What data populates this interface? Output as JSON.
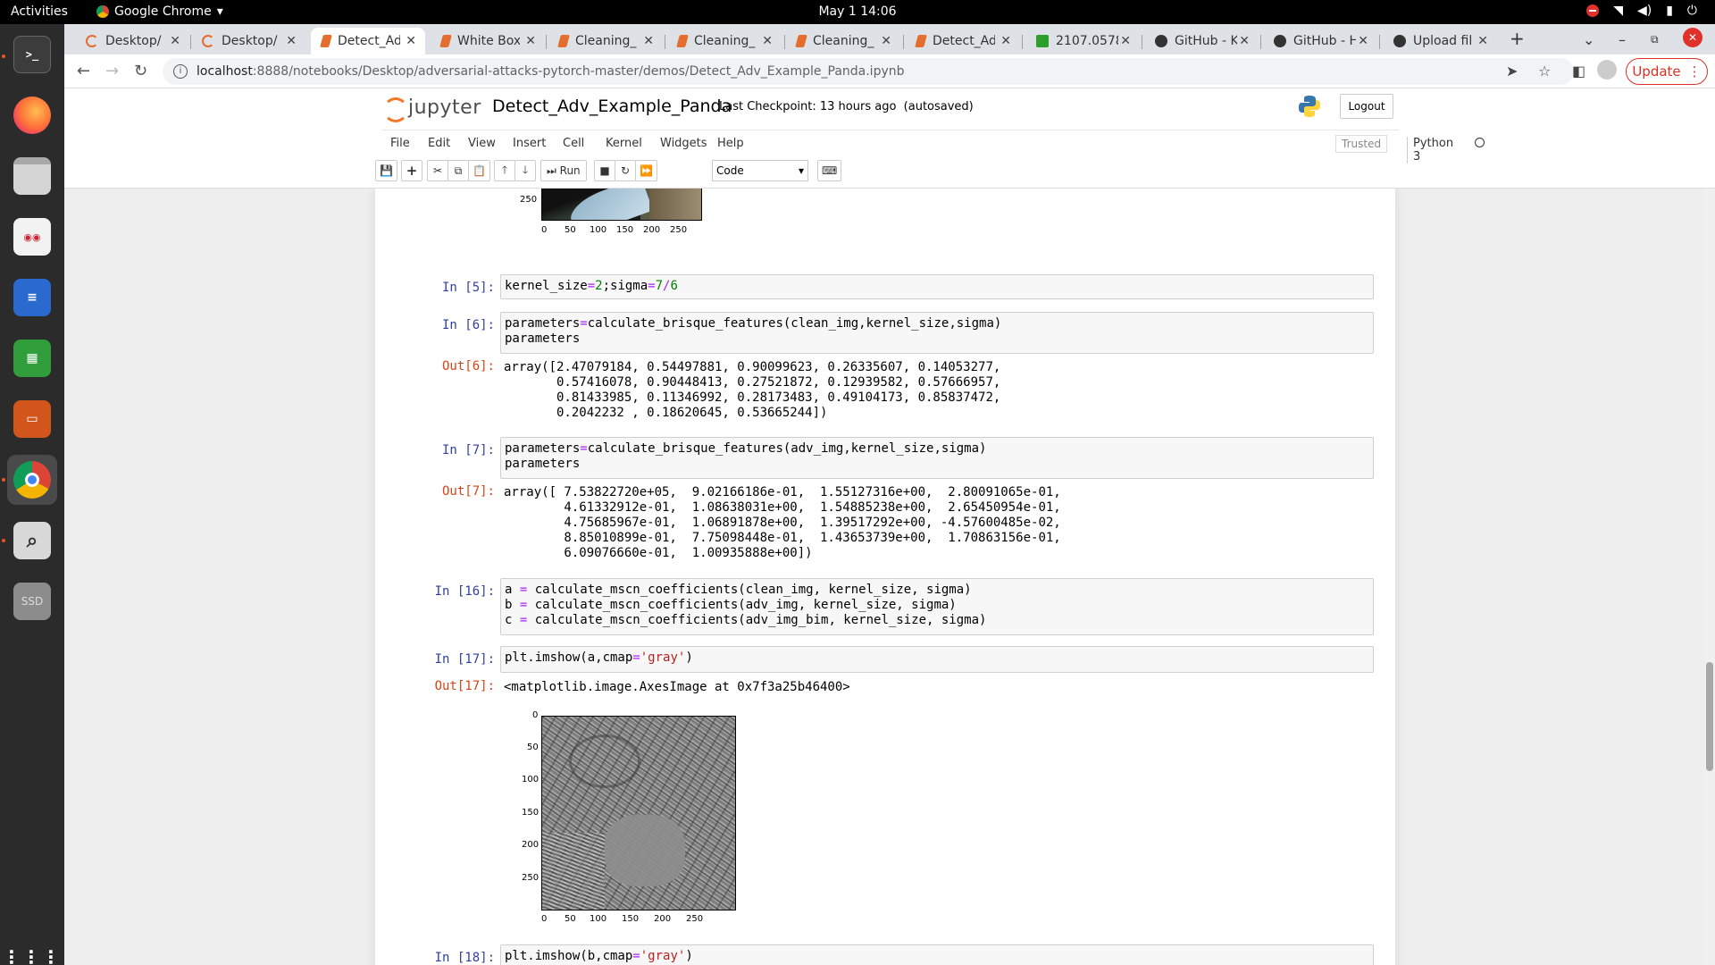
{
  "system": {
    "activities": "Activities",
    "app_menu": "Google Chrome",
    "clock": "May 1  14:06"
  },
  "browser": {
    "tabs": [
      {
        "title": "Desktop/",
        "icon": "jupyter-icon"
      },
      {
        "title": "Desktop/",
        "icon": "jupyter-icon"
      },
      {
        "title": "Detect_Ad",
        "icon": "notebook-icon",
        "active": true
      },
      {
        "title": "White Box",
        "icon": "notebook-icon"
      },
      {
        "title": "Cleaning_",
        "icon": "notebook-icon"
      },
      {
        "title": "Cleaning_",
        "icon": "notebook-icon"
      },
      {
        "title": "Cleaning_",
        "icon": "notebook-icon"
      },
      {
        "title": "Detect_Ad",
        "icon": "notebook-icon"
      },
      {
        "title": "2107.0578",
        "icon": "arxiv-icon"
      },
      {
        "title": "GitHub - K",
        "icon": "github-icon"
      },
      {
        "title": "GitHub - H",
        "icon": "github-icon"
      },
      {
        "title": "Upload fil",
        "icon": "github-icon"
      }
    ],
    "url_host": "localhost",
    "url_path": ":8888/notebooks/Desktop/adversarial-attacks-pytorch-master/demos/Detect_Adv_Example_Panda.ipynb",
    "update_label": "Update"
  },
  "jupyter": {
    "logo_text": "jupyter",
    "notebook_name": "Detect_Adv_Example_Panda",
    "checkpoint": "Last Checkpoint: 13 hours ago",
    "autosave": "(autosaved)",
    "logout": "Logout",
    "menu": [
      "File",
      "Edit",
      "View",
      "Insert",
      "Cell",
      "Kernel",
      "Widgets",
      "Help"
    ],
    "trusted": "Trusted",
    "kernel": "Python 3",
    "run_label": "Run",
    "cell_type": "Code"
  },
  "cells": {
    "plot_top": {
      "yticks": [
        "250"
      ],
      "xticks": [
        "0",
        "50",
        "100",
        "150",
        "200",
        "250"
      ]
    },
    "in5": {
      "prompt": "In [5]:"
    },
    "in6": {
      "prompt": "In [6]:",
      "line2": "parameters"
    },
    "out6": {
      "prompt": "Out[6]:",
      "text": "array([2.47079184, 0.54497881, 0.90099623, 0.26335607, 0.14053277,\n       0.57416078, 0.90448413, 0.27521872, 0.12939582, 0.57666957,\n       0.81433985, 0.11346992, 0.28173483, 0.49104173, 0.85837472,\n       0.2042232 , 0.18620645, 0.53665244])"
    },
    "in7": {
      "prompt": "In [7]:",
      "line2": "parameters"
    },
    "out7": {
      "prompt": "Out[7]:",
      "text": "array([ 7.53822720e+05,  9.02166186e-01,  1.55127316e+00,  2.80091065e-01,\n        4.61332912e-01,  1.08638031e+00,  1.54885238e+00,  2.65450954e-01,\n        4.75685967e-01,  1.06891878e+00,  1.39517292e+00, -4.57600485e-02,\n        8.85010899e-01,  7.75098448e-01,  1.43653739e+00,  1.70863156e-01,\n        6.09076660e-01,  1.00935888e+00])"
    },
    "in16": {
      "prompt": "In [16]:"
    },
    "in17": {
      "prompt": "In [17]:"
    },
    "out17": {
      "prompt": "Out[17]:",
      "text": "<matplotlib.image.AxesImage at 0x7f3a25b46400>"
    },
    "plot_mscn": {
      "yticks": [
        "0",
        "50",
        "100",
        "150",
        "200",
        "250"
      ],
      "xticks": [
        "0",
        "50",
        "100",
        "150",
        "200",
        "250"
      ]
    },
    "in18": {
      "prompt": "In [18]:"
    }
  }
}
